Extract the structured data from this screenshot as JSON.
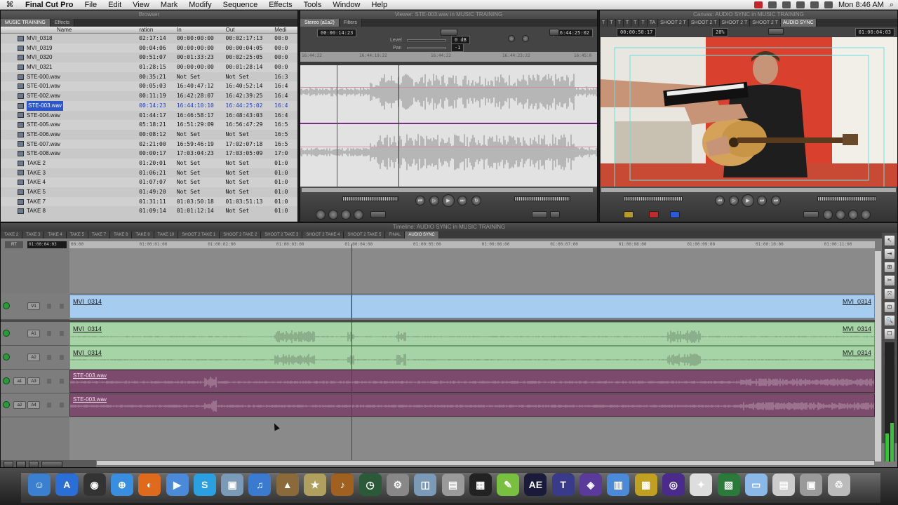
{
  "menubar": {
    "app_name": "Final Cut Pro",
    "menus": [
      "File",
      "Edit",
      "View",
      "Mark",
      "Modify",
      "Sequence",
      "Effects",
      "Tools",
      "Window",
      "Help"
    ],
    "clock": "Mon 8:46 AM"
  },
  "browser": {
    "title": "Browser",
    "tabs": [
      "MUSIC TRAINING",
      "Effects"
    ],
    "columns": {
      "name": "Name",
      "duration": "ration",
      "in": "In",
      "out": "Out",
      "media": "Medi"
    },
    "rows": [
      {
        "name": "MVI_0318",
        "duration": "02:17:14",
        "in": "00:00:00:00",
        "out": "00:02:17:13",
        "media": "00:0"
      },
      {
        "name": "MVI_0319",
        "duration": "00:04:06",
        "in": "00:00:00:00",
        "out": "00:00:04:05",
        "media": "00:0"
      },
      {
        "name": "MVI_0320",
        "duration": "00:51:07",
        "in": "00:01:33:23",
        "out": "00:02:25:05",
        "media": "00:0"
      },
      {
        "name": "MVI_0321",
        "duration": "01:28:15",
        "in": "00:00:00:00",
        "out": "00:01:28:14",
        "media": "00:0"
      },
      {
        "name": "STE-000.wav",
        "duration": "00:35:21",
        "in": "Not Set",
        "out": "Not Set",
        "media": "16:3"
      },
      {
        "name": "STE-001.wav",
        "duration": "00:05:03",
        "in": "16:40:47:12",
        "out": "16:40:52:14",
        "media": "16:4"
      },
      {
        "name": "STE-002.wav",
        "duration": "00:11:19",
        "in": "16:42:28:07",
        "out": "16:42:39:25",
        "media": "16:4"
      },
      {
        "name": "STE-003.wav",
        "duration": "00:14:23",
        "in": "16:44:10:10",
        "out": "16:44:25:02",
        "media": "16:4",
        "selected": true
      },
      {
        "name": "STE-004.wav",
        "duration": "01:44:17",
        "in": "16:46:58:17",
        "out": "16:48:43:03",
        "media": "16:4"
      },
      {
        "name": "STE-005.wav",
        "duration": "05:18:21",
        "in": "16:51:29:09",
        "out": "16:56:47:29",
        "media": "16:5"
      },
      {
        "name": "STE-006.wav",
        "duration": "00:08:12",
        "in": "Not Set",
        "out": "Not Set",
        "media": "16:5"
      },
      {
        "name": "STE-007.wav",
        "duration": "02:21:00",
        "in": "16:59:46:19",
        "out": "17:02:07:18",
        "media": "16:5"
      },
      {
        "name": "STE-008.wav",
        "duration": "00:00:17",
        "in": "17:03:04:23",
        "out": "17:03:05:09",
        "media": "17:0"
      },
      {
        "name": "TAKE 2",
        "duration": "01:20:01",
        "in": "Not Set",
        "out": "Not Set",
        "media": "01:0"
      },
      {
        "name": "TAKE 3",
        "duration": "01:06:21",
        "in": "Not Set",
        "out": "Not Set",
        "media": "01:0"
      },
      {
        "name": "TAKE 4",
        "duration": "01:07:07",
        "in": "Not Set",
        "out": "Not Set",
        "media": "01:0"
      },
      {
        "name": "TAKE 5",
        "duration": "01:49:20",
        "in": "Not Set",
        "out": "Not Set",
        "media": "01:0"
      },
      {
        "name": "TAKE 7",
        "duration": "01:31:11",
        "in": "01:03:50:18",
        "out": "01:03:51:13",
        "media": "01:0"
      },
      {
        "name": "TAKE 8",
        "duration": "01:09:14",
        "in": "01:01:12:14",
        "out": "Not Set",
        "media": "01:0"
      }
    ]
  },
  "viewer": {
    "title": "Viewer: STE-003.wav in MUSIC TRAINING",
    "tabs": [
      "Stereo (a1a2)",
      "Filters"
    ],
    "timecode_left": "00:00:14:23",
    "timecode_right": "16:44:25:02",
    "level_label": "Level",
    "level_value": "0 dB",
    "pan_label": "Pan",
    "pan_value": "-1",
    "ruler_ticks": [
      "16:44:22",
      "16:44:19:22",
      "16:44:22",
      "16:44:23:22",
      "16:45:0"
    ]
  },
  "canvas": {
    "title": "Canvas: AUDIO SYNC in MUSIC TRAINING",
    "tabs": [
      "T",
      "T",
      "T",
      "T",
      "T",
      "T",
      "TA",
      "SHOOT 2 T",
      "SHOOT 2 T",
      "SHOOT 2 T",
      "SHOOT 2 T",
      "AUDIO SYNC"
    ],
    "timecode_left": "00:00:50:17",
    "zoom": "28%",
    "timecode_right": "01:00:04:03"
  },
  "timeline": {
    "title": "Timeline: AUDIO SYNC in MUSIC TRAINING",
    "sequence_tabs": [
      "TAKE 2",
      "TAKE 3",
      "TAKE 4",
      "TAKE 5",
      "TAKE 7",
      "TAKE 8",
      "TAKE 9",
      "TAKE 10",
      "SHOOT 2 TAKE 1",
      "SHOOT 2 TAKE 2",
      "SHOOT 2 TAKE 3",
      "SHOOT 2 TAKE 4",
      "SHOOT 2 TAKE 5",
      "FINAL",
      "AUDIO SYNC"
    ],
    "rt_label": "RT",
    "current_timecode": "01:00:04:03",
    "ruler_ticks": [
      "00:00",
      "01:00:01:00",
      "01:00:02:00",
      "01:00:03:00",
      "01:00:04:00",
      "01:00:05:00",
      "01:00:06:00",
      "01:00:07:00",
      "01:00:08:00",
      "01:00:09:00",
      "01:00:10:00",
      "01:00:11:00"
    ],
    "tracks": [
      {
        "id": "v1",
        "patch": "V1",
        "clip": "MVI_0314",
        "clip_end": "MVI_0314",
        "color": "#a6ccf0"
      },
      {
        "id": "a1",
        "patch": "A1",
        "clip": "MVI_0314",
        "clip_end": "MVI_0314",
        "color": "#a6d4a6"
      },
      {
        "id": "a2",
        "patch": "A2",
        "clip": "MVI_0314",
        "clip_end": "MVI_0314",
        "color": "#a6d4a6"
      },
      {
        "id": "a3",
        "patch": "A3",
        "src": "a1",
        "clip": "STE-003.wav",
        "color": "#7b4a6d"
      },
      {
        "id": "a4",
        "patch": "A4",
        "src": "a2",
        "clip": "STE-003.wav",
        "color": "#7b4a6d"
      }
    ]
  },
  "tools": [
    "↖",
    "⇥",
    "⊞",
    "✂",
    "⤧",
    "⊡",
    "🔍",
    "☐",
    "✎",
    "⊕"
  ],
  "dock": {
    "apps": [
      {
        "name": "finder-icon",
        "color": "#3a7fd0",
        "glyph": "☺"
      },
      {
        "name": "app-store-icon",
        "color": "#2a6fd8",
        "glyph": "A"
      },
      {
        "name": "dashboard-icon",
        "color": "#333333",
        "glyph": "◉"
      },
      {
        "name": "safari-icon",
        "color": "#3a8ee0",
        "glyph": "⊕"
      },
      {
        "name": "firefox-icon",
        "color": "#e06a1c",
        "glyph": "◐"
      },
      {
        "name": "facetime-icon",
        "color": "#4a8ad8",
        "glyph": "▶"
      },
      {
        "name": "skype-icon",
        "color": "#2aa0e0",
        "glyph": "S"
      },
      {
        "name": "preview-icon",
        "color": "#7a9ab8",
        "glyph": "▣"
      },
      {
        "name": "itunes-icon",
        "color": "#3a7ad0",
        "glyph": "♫"
      },
      {
        "name": "iphoto-icon",
        "color": "#8a6a3a",
        "glyph": "▲"
      },
      {
        "name": "imovie-icon",
        "color": "#b0a060",
        "glyph": "★"
      },
      {
        "name": "garageband-icon",
        "color": "#a06020",
        "glyph": "♪"
      },
      {
        "name": "time-machine-icon",
        "color": "#2a5a3a",
        "glyph": "◷"
      },
      {
        "name": "system-preferences-icon",
        "color": "#888888",
        "glyph": "⚙"
      },
      {
        "name": "image-capture-icon",
        "color": "#7a9ab8",
        "glyph": "◫"
      },
      {
        "name": "scanner-icon",
        "color": "#9a9a9a",
        "glyph": "▤"
      },
      {
        "name": "clapper-icon",
        "color": "#222222",
        "glyph": "▦"
      },
      {
        "name": "pencil-icon",
        "color": "#7ac040",
        "glyph": "✎"
      },
      {
        "name": "after-effects-icon",
        "color": "#1a1a3a",
        "glyph": "AE"
      },
      {
        "name": "motion-icon",
        "color": "#3a3a8a",
        "glyph": "T"
      },
      {
        "name": "color-icon",
        "color": "#5a3a9a",
        "glyph": "◈"
      },
      {
        "name": "compressor-icon",
        "color": "#4a8ad8",
        "glyph": "▥"
      },
      {
        "name": "dvd-studio-icon",
        "color": "#c0a020",
        "glyph": "▩"
      },
      {
        "name": "dvd-player-icon",
        "color": "#4a2a8a",
        "glyph": "◎"
      },
      {
        "name": "grapher-icon",
        "color": "#dddddd",
        "glyph": "✦"
      },
      {
        "name": "photo-booth-icon",
        "color": "#2a7a3a",
        "glyph": "▧"
      },
      {
        "name": "downloads-folder-icon",
        "color": "#8ab8e8",
        "glyph": "▭"
      },
      {
        "name": "documents-stack-icon",
        "color": "#cccccc",
        "glyph": "▤"
      },
      {
        "name": "screenshots-stack-icon",
        "color": "#9a9a9a",
        "glyph": "▣"
      },
      {
        "name": "trash-icon",
        "color": "#bbbbbb",
        "glyph": "♲"
      }
    ]
  }
}
